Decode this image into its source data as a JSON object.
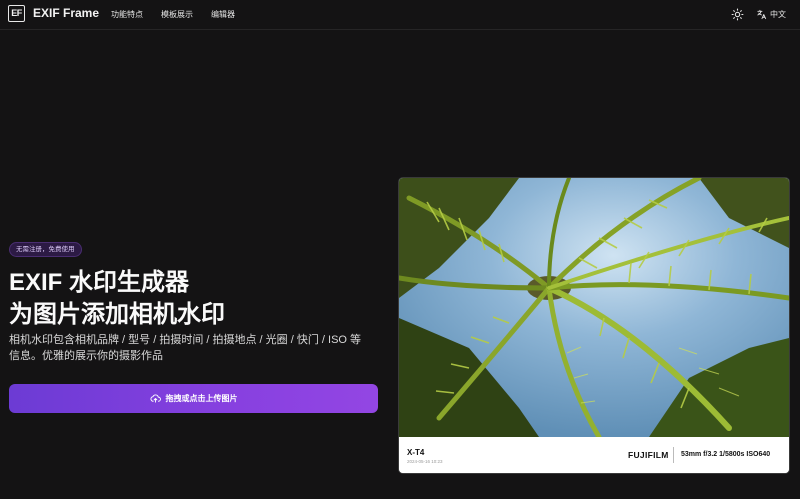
{
  "header": {
    "logo_mark": "EF",
    "app_name": "EXIF Frame",
    "nav": [
      "功能特点",
      "模板展示",
      "编辑器"
    ],
    "theme_icon": "sun-icon",
    "lang_icon": "translate-icon",
    "language": "中文"
  },
  "hero": {
    "badge": "无需注册，免费使用",
    "title_line1": "EXIF 水印生成器",
    "title_line2": "为图片添加相机水印",
    "description": "相机水印包含相机品牌 / 型号 / 拍摄时间 / 拍摄地点 / 光圈 / 快门 / ISO 等信息。优雅的展示你的摄影作品",
    "upload_icon": "upload-cloud-icon",
    "upload_label": "拖拽或点击上传图片",
    "accent_color": "#7c3aed"
  },
  "preview": {
    "camera_model": "X-T4",
    "datetime": "2024-05-16 10:23",
    "brand": "FUJIFILM",
    "params": "53mm f/3.2 1/5800s ISO640"
  }
}
